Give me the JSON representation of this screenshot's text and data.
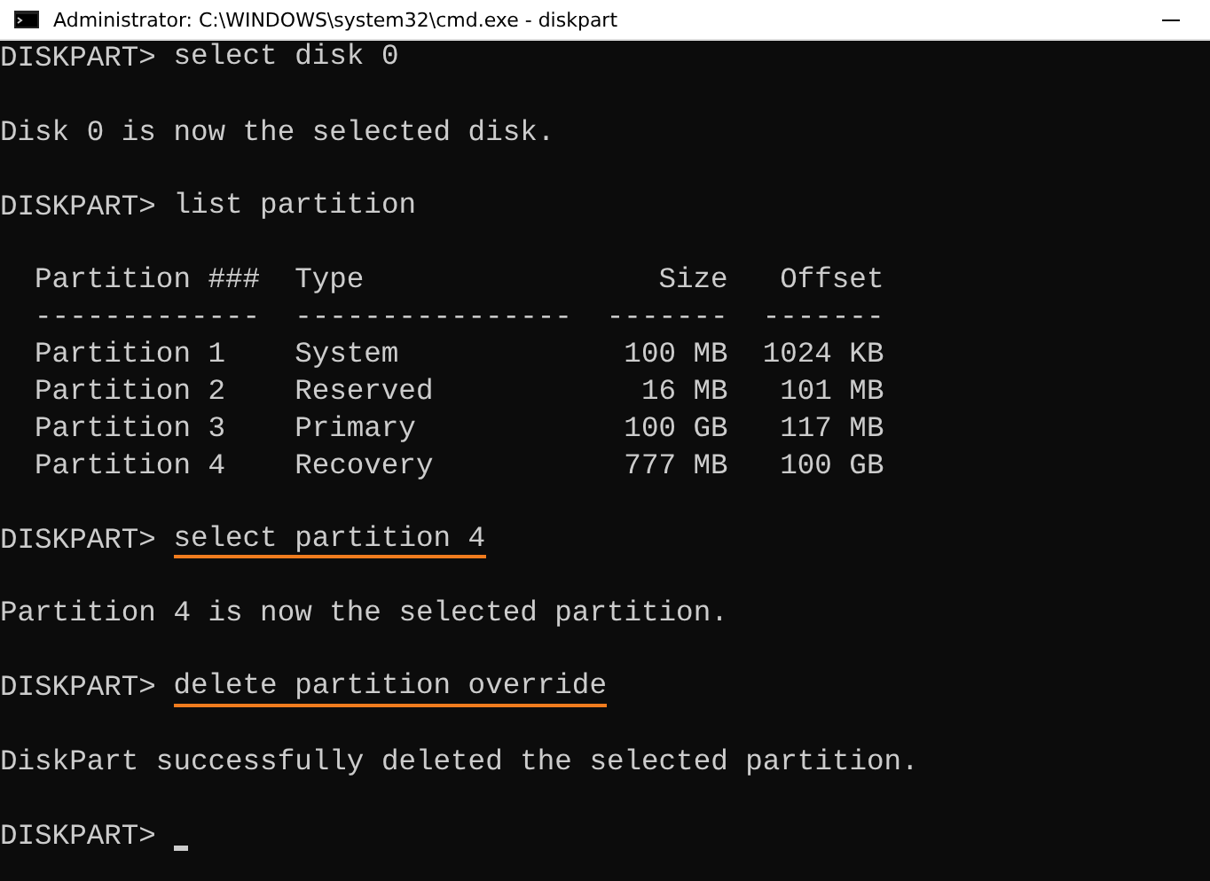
{
  "window": {
    "title": "Administrator: C:\\WINDOWS\\system32\\cmd.exe - diskpart"
  },
  "lines": [
    {
      "kind": "command",
      "prompt": "DISKPART>",
      "command": "select disk 0",
      "highlighted": false
    },
    {
      "kind": "blank"
    },
    {
      "kind": "output",
      "text": "Disk 0 is now the selected disk."
    },
    {
      "kind": "blank"
    },
    {
      "kind": "command",
      "prompt": "DISKPART>",
      "command": "list partition",
      "highlighted": false
    },
    {
      "kind": "blank"
    },
    {
      "kind": "table",
      "columns": [
        "Partition ###",
        "Type",
        "Size",
        "Offset"
      ],
      "separators": [
        "-------------",
        "----------------",
        "-------",
        "-------"
      ],
      "rows": [
        [
          "Partition 1",
          "System",
          "100 MB",
          "1024 KB"
        ],
        [
          "Partition 2",
          "Reserved",
          "16 MB",
          "101 MB"
        ],
        [
          "Partition 3",
          "Primary",
          "100 GB",
          "117 MB"
        ],
        [
          "Partition 4",
          "Recovery",
          "777 MB",
          "100 GB"
        ]
      ]
    },
    {
      "kind": "blank"
    },
    {
      "kind": "command",
      "prompt": "DISKPART>",
      "command": "select partition 4",
      "highlighted": true
    },
    {
      "kind": "blank"
    },
    {
      "kind": "output",
      "text": "Partition 4 is now the selected partition."
    },
    {
      "kind": "blank"
    },
    {
      "kind": "command",
      "prompt": "DISKPART>",
      "command": "delete partition override",
      "highlighted": true
    },
    {
      "kind": "blank"
    },
    {
      "kind": "output",
      "text": "DiskPart successfully deleted the selected partition."
    },
    {
      "kind": "blank"
    },
    {
      "kind": "prompt",
      "prompt": "DISKPART>",
      "cursor": true
    }
  ]
}
